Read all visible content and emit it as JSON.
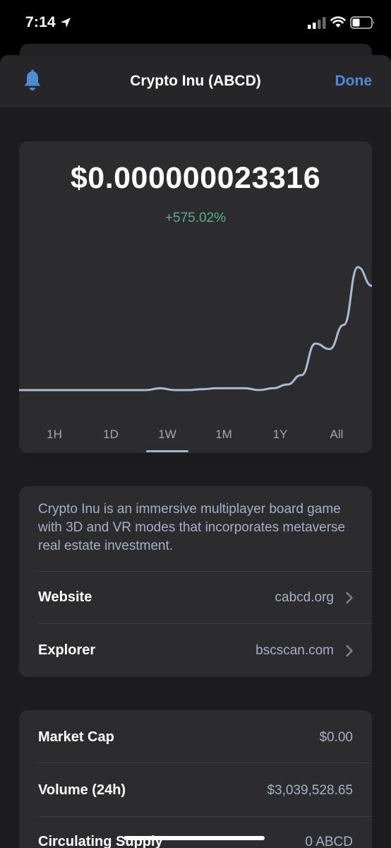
{
  "status_bar": {
    "time": "7:14"
  },
  "nav": {
    "title": "Crypto Inu (ABCD)",
    "done_label": "Done"
  },
  "price_card": {
    "price": "$0.000000023316",
    "change": "+575.02%",
    "ranges": [
      "1H",
      "1D",
      "1W",
      "1M",
      "1Y",
      "All"
    ],
    "selected_range": "1W"
  },
  "chart_data": {
    "type": "line",
    "series": [
      {
        "values": [
          1.0,
          1.0,
          1.0,
          1.0,
          1.0,
          1.0,
          1.0,
          1.0,
          1.0,
          1.0,
          1.1,
          1.0,
          1.0,
          1.05,
          1.1,
          1.1,
          1.1,
          1.0,
          1.1,
          1.3,
          1.8,
          3.5,
          3.2,
          4.5,
          7.6,
          6.6
        ]
      }
    ]
  },
  "about": {
    "description": "Crypto Inu is an immersive multiplayer board game with 3D and VR modes that incorporates metaverse real estate investment.",
    "website_label": "Website",
    "website_value": "cabcd.org",
    "explorer_label": "Explorer",
    "explorer_value": "bscscan.com"
  },
  "stats": {
    "market_cap_label": "Market Cap",
    "market_cap_value": "$0.00",
    "volume_label": "Volume (24h)",
    "volume_value": "$3,039,528.65",
    "supply_label": "Circulating Supply",
    "supply_value": "0 ABCD"
  },
  "colors": {
    "accent": "#4f8bd3",
    "positive": "#5cae8f",
    "line": "#a9bad4"
  },
  "icons": [
    "location-arrow-icon",
    "signal-icon",
    "wifi-icon",
    "battery-icon",
    "bell-icon",
    "chevron-right-icon"
  ]
}
